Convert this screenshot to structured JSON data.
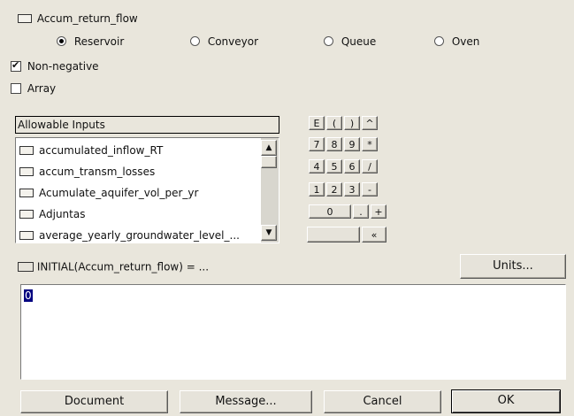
{
  "variable": {
    "name": "Accum_return_flow"
  },
  "types": [
    {
      "label": "Reservoir",
      "selected": true
    },
    {
      "label": "Conveyor",
      "selected": false
    },
    {
      "label": "Queue",
      "selected": false
    },
    {
      "label": "Oven",
      "selected": false
    }
  ],
  "options": {
    "non_negative": {
      "label": "Non-negative",
      "checked": true
    },
    "array": {
      "label": "Array",
      "checked": false
    }
  },
  "inputs": {
    "header": "Allowable Inputs",
    "items": [
      "accumulated_inflow_RT",
      "accum_transm_losses",
      "Acumulate_aquifer_vol_per_yr",
      "Adjuntas",
      "average_yearly_groundwater_level_..."
    ]
  },
  "keypad": {
    "row1": [
      "E",
      "(",
      ")",
      "^"
    ],
    "row2": [
      "7",
      "8",
      "9",
      "*"
    ],
    "row3": [
      "4",
      "5",
      "6",
      "/"
    ],
    "row4": [
      "1",
      "2",
      "3",
      "-"
    ],
    "row5": [
      "0",
      ".",
      "+"
    ],
    "row6_right": "«"
  },
  "equation": {
    "label": "INITIAL(Accum_return_flow) = ...",
    "value": "0"
  },
  "buttons": {
    "units": "Units...",
    "document": "Document",
    "message": "Message...",
    "cancel": "Cancel",
    "ok": "OK"
  }
}
